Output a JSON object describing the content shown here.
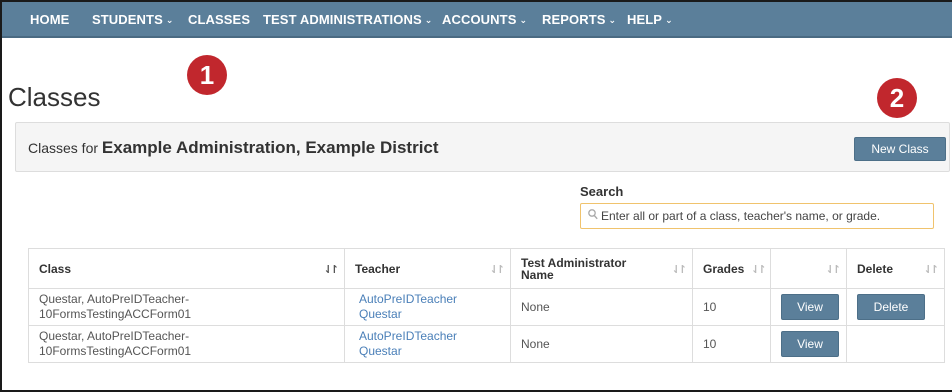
{
  "nav": {
    "items": [
      {
        "label": "HOME",
        "dropdown": false
      },
      {
        "label": "STUDENTS",
        "dropdown": true
      },
      {
        "label": "CLASSES",
        "dropdown": false
      },
      {
        "label": "TEST ADMINISTRATIONS",
        "dropdown": true
      },
      {
        "label": "ACCOUNTS",
        "dropdown": true
      },
      {
        "label": "REPORTS",
        "dropdown": true
      },
      {
        "label": "HELP",
        "dropdown": true
      }
    ],
    "chevron": "⌄"
  },
  "callouts": {
    "one": "1",
    "two": "2"
  },
  "page": {
    "title": "Classes"
  },
  "panel": {
    "prefix": "Classes for",
    "context": "Example Administration, Example District",
    "new_class_label": "New Class"
  },
  "search": {
    "label": "Search",
    "placeholder": "Enter all or part of a class, teacher's name, or grade."
  },
  "table": {
    "headers": {
      "class": "Class",
      "teacher": "Teacher",
      "test_admin": "Test Administrator Name",
      "grades": "Grades",
      "actions": "",
      "delete": "Delete"
    },
    "rows": [
      {
        "class_line1": "Questar, AutoPreIDTeacher-",
        "class_line2": "10FormsTestingACCForm01",
        "teacher_line1": "AutoPreIDTeacher",
        "teacher_line2": "Questar",
        "test_admin": "None",
        "grades": "10",
        "view_label": "View",
        "delete_label": "Delete"
      },
      {
        "class_line1": "Questar, AutoPreIDTeacher-",
        "class_line2": "10FormsTestingACCForm01",
        "teacher_line1": "AutoPreIDTeacher",
        "teacher_line2": "Questar",
        "test_admin": "None",
        "grades": "10",
        "view_label": "View",
        "delete_label": ""
      }
    ]
  },
  "colors": {
    "nav_bg": "#5b7f9a",
    "button_bg": "#5b7f9a",
    "callout": "#c1272d",
    "link": "#4a7fb8",
    "search_border": "#f0c36d"
  }
}
